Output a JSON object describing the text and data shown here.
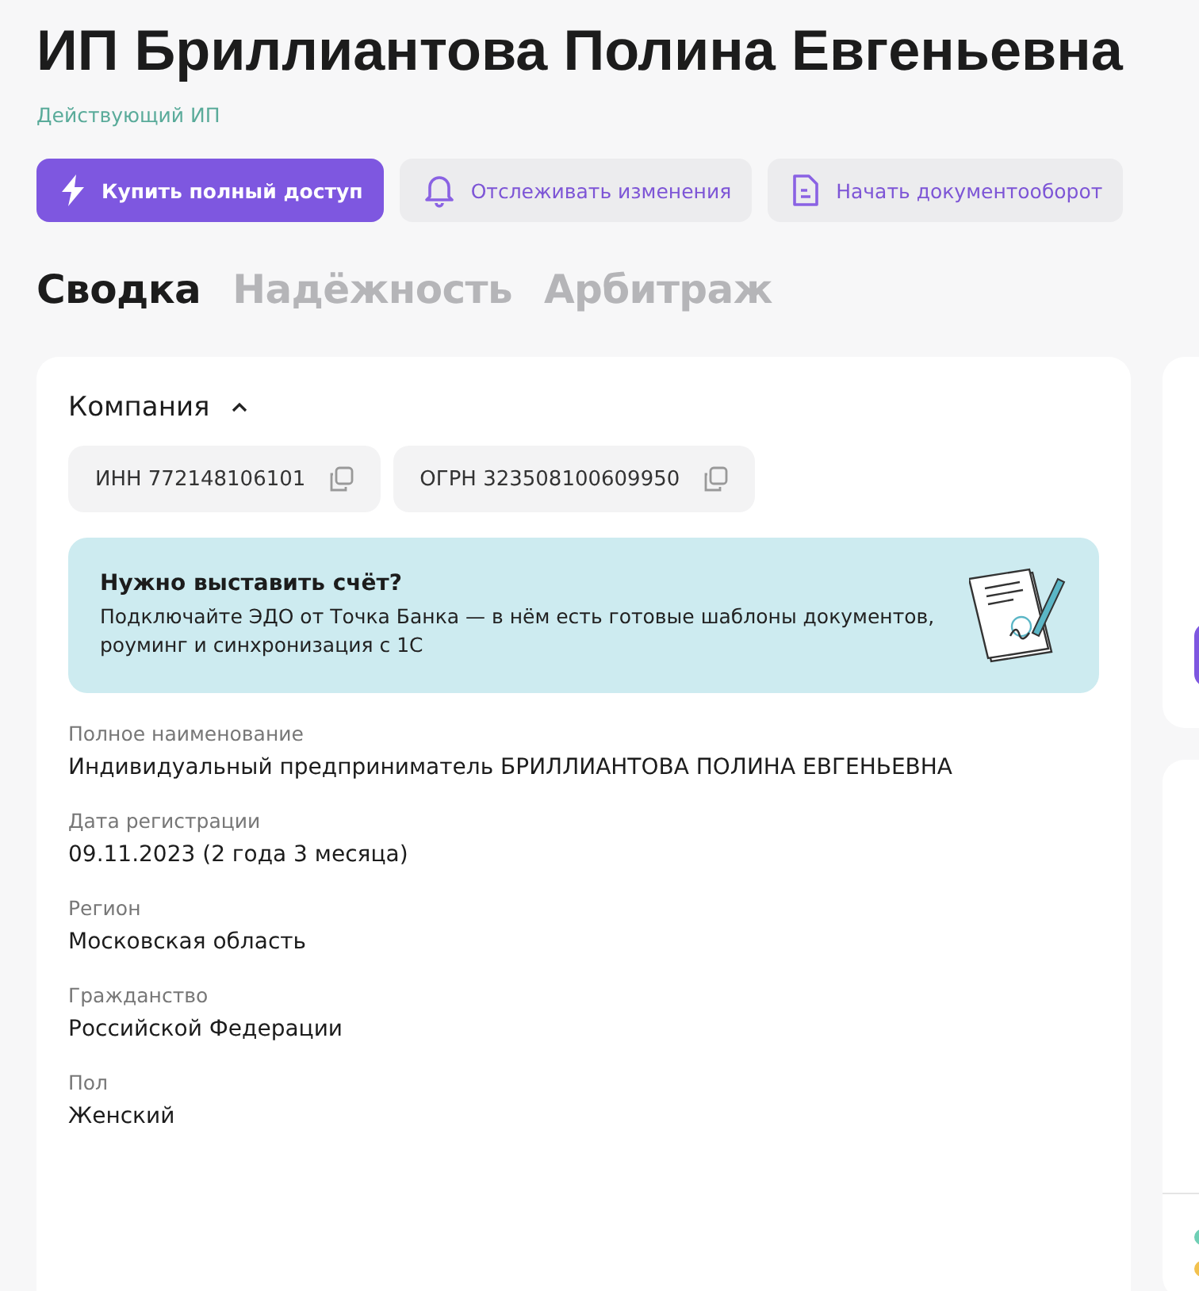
{
  "title": "ИП Бриллиантова Полина Евгеньевна",
  "status": "Действующий ИП",
  "actions": [
    {
      "kind": "primary",
      "label": "Купить полный доступ"
    },
    {
      "kind": "secondary",
      "label": "Отслеживать изменения"
    },
    {
      "kind": "secondary",
      "label": "Начать документооборот"
    }
  ],
  "tabs": [
    {
      "label": "Сводка",
      "selected": true
    },
    {
      "label": "Надёжность",
      "selected": false
    },
    {
      "label": "Арбитраж",
      "selected": false
    }
  ],
  "company": {
    "heading": "Компания",
    "expanded": true,
    "codes": [
      "ИНН 772148106101",
      "ОГРН 323508100609950"
    ],
    "banner": {
      "title": "Нужно выставить счёт?",
      "text": "Подключайте ЭДО от Точка Банка — в нём есть готовые шаблоны документов, роуминг и синхронизация с 1С"
    },
    "fields": [
      {
        "label": "Полное наименование",
        "value": "Индивидуальный предприниматель БРИЛЛИАНТОВА ПОЛИНА ЕВГЕНЬЕВНА"
      },
      {
        "label": "Дата регистрации",
        "value": "09.11.2023 (2 года 3 месяца)"
      },
      {
        "label": "Регион",
        "value": "Московская область"
      },
      {
        "label": "Гражданство",
        "value": "Российской Федерации"
      },
      {
        "label": "Пол",
        "value": "Женский"
      }
    ]
  },
  "side_markers": [
    {
      "color": "#6fcfb5"
    },
    {
      "color": "#f2c14e"
    }
  ]
}
